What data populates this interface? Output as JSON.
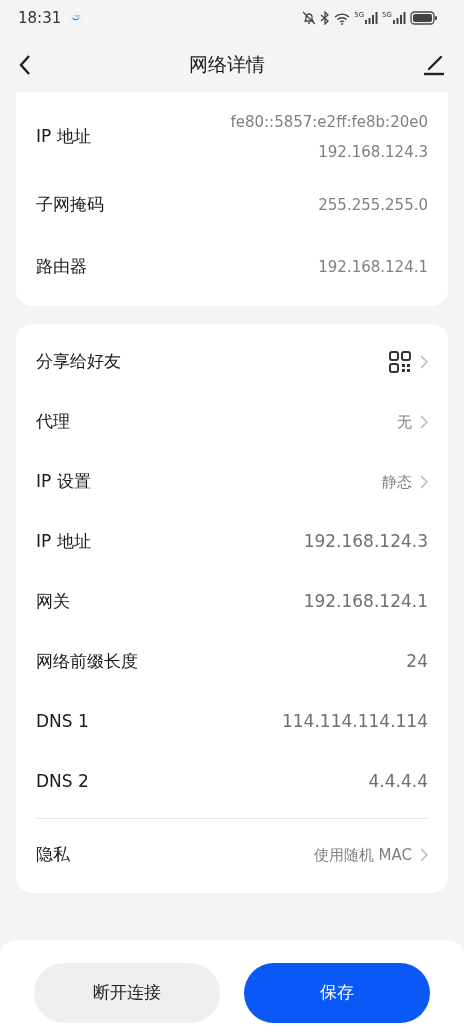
{
  "status_bar": {
    "time": "18:31",
    "signal_labels": [
      "5G",
      "5G"
    ]
  },
  "header": {
    "title": "网络详情"
  },
  "info_card": {
    "rows": [
      {
        "label": "IP 地址",
        "values": [
          "fe80::5857:e2ff:fe8b:20e0",
          "192.168.124.3"
        ]
      },
      {
        "label": "子网掩码",
        "values": [
          "255.255.255.0"
        ]
      },
      {
        "label": "路由器",
        "values": [
          "192.168.124.1"
        ]
      }
    ]
  },
  "settings_card": {
    "groups": [
      [
        {
          "label": "分享给好友",
          "kind": "qr"
        },
        {
          "label": "代理",
          "kind": "link",
          "value": "无"
        },
        {
          "label": "IP 设置",
          "kind": "link",
          "value": "静态"
        },
        {
          "label": "IP 地址",
          "kind": "value",
          "value": "192.168.124.3"
        },
        {
          "label": "网关",
          "kind": "value",
          "value": "192.168.124.1"
        },
        {
          "label": "网络前缀长度",
          "kind": "value",
          "value": "24"
        },
        {
          "label": "DNS 1",
          "kind": "value",
          "value": "114.114.114.114"
        },
        {
          "label": "DNS 2",
          "kind": "value",
          "value": "4.4.4.4"
        }
      ],
      [
        {
          "label": "隐私",
          "kind": "link",
          "value": "使用随机 MAC"
        }
      ]
    ]
  },
  "buttons": [
    {
      "label": "断开连接",
      "primary": false
    },
    {
      "label": "保存",
      "primary": true
    }
  ]
}
